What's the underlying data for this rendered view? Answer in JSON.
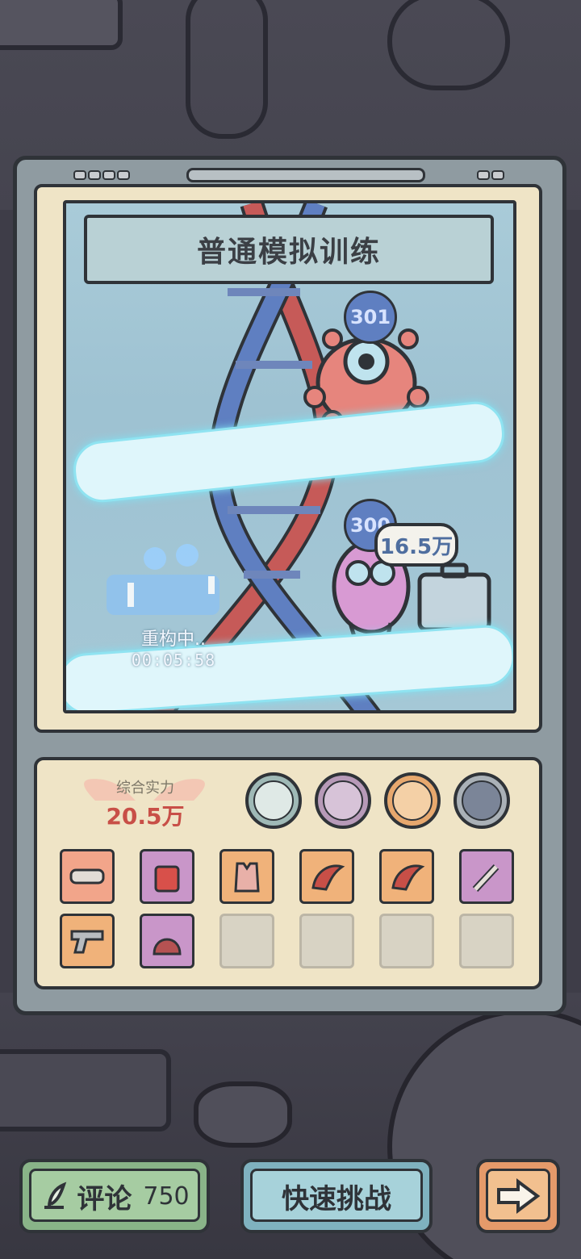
{
  "title": "普通模拟训练",
  "levels": {
    "upper_level": "301",
    "lower_level": "300"
  },
  "enemy_power_bubble": "16.5万",
  "rebuild": {
    "status": "重构中..",
    "timer": "00:05:58"
  },
  "stats": {
    "power_label": "综合实力",
    "power_value": "20.5万"
  },
  "skills": [
    "angel-skill-icon",
    "rune-skill-icon",
    "chest-skill-icon",
    "heal-skill-icon"
  ],
  "equipment": [
    {
      "name": "visor",
      "bg": "#f2a58a"
    },
    {
      "name": "tag",
      "bg": "#c996c9"
    },
    {
      "name": "armor-vest",
      "bg": "#f0b27a"
    },
    {
      "name": "wing-boots",
      "bg": "#f0b27a"
    },
    {
      "name": "wing-boots-2",
      "bg": "#f0b27a"
    },
    {
      "name": "wrench",
      "bg": "#c996c9"
    },
    {
      "name": "pistol",
      "bg": "#f0b27a"
    },
    {
      "name": "helmet",
      "bg": "#c996c9"
    }
  ],
  "buttons": {
    "comment_label": "评论",
    "comment_count": "750",
    "fast_challenge_label": "快速挑战"
  }
}
